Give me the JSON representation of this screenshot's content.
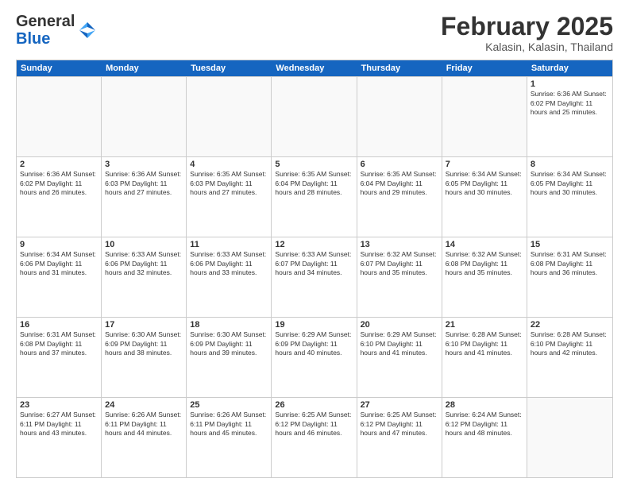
{
  "logo": {
    "general": "General",
    "blue": "Blue"
  },
  "header": {
    "month": "February 2025",
    "location": "Kalasin, Kalasin, Thailand"
  },
  "weekdays": [
    "Sunday",
    "Monday",
    "Tuesday",
    "Wednesday",
    "Thursday",
    "Friday",
    "Saturday"
  ],
  "rows": [
    [
      {
        "day": "",
        "info": ""
      },
      {
        "day": "",
        "info": ""
      },
      {
        "day": "",
        "info": ""
      },
      {
        "day": "",
        "info": ""
      },
      {
        "day": "",
        "info": ""
      },
      {
        "day": "",
        "info": ""
      },
      {
        "day": "1",
        "info": "Sunrise: 6:36 AM\nSunset: 6:02 PM\nDaylight: 11 hours and 25 minutes."
      }
    ],
    [
      {
        "day": "2",
        "info": "Sunrise: 6:36 AM\nSunset: 6:02 PM\nDaylight: 11 hours and 26 minutes."
      },
      {
        "day": "3",
        "info": "Sunrise: 6:36 AM\nSunset: 6:03 PM\nDaylight: 11 hours and 27 minutes."
      },
      {
        "day": "4",
        "info": "Sunrise: 6:35 AM\nSunset: 6:03 PM\nDaylight: 11 hours and 27 minutes."
      },
      {
        "day": "5",
        "info": "Sunrise: 6:35 AM\nSunset: 6:04 PM\nDaylight: 11 hours and 28 minutes."
      },
      {
        "day": "6",
        "info": "Sunrise: 6:35 AM\nSunset: 6:04 PM\nDaylight: 11 hours and 29 minutes."
      },
      {
        "day": "7",
        "info": "Sunrise: 6:34 AM\nSunset: 6:05 PM\nDaylight: 11 hours and 30 minutes."
      },
      {
        "day": "8",
        "info": "Sunrise: 6:34 AM\nSunset: 6:05 PM\nDaylight: 11 hours and 30 minutes."
      }
    ],
    [
      {
        "day": "9",
        "info": "Sunrise: 6:34 AM\nSunset: 6:06 PM\nDaylight: 11 hours and 31 minutes."
      },
      {
        "day": "10",
        "info": "Sunrise: 6:33 AM\nSunset: 6:06 PM\nDaylight: 11 hours and 32 minutes."
      },
      {
        "day": "11",
        "info": "Sunrise: 6:33 AM\nSunset: 6:06 PM\nDaylight: 11 hours and 33 minutes."
      },
      {
        "day": "12",
        "info": "Sunrise: 6:33 AM\nSunset: 6:07 PM\nDaylight: 11 hours and 34 minutes."
      },
      {
        "day": "13",
        "info": "Sunrise: 6:32 AM\nSunset: 6:07 PM\nDaylight: 11 hours and 35 minutes."
      },
      {
        "day": "14",
        "info": "Sunrise: 6:32 AM\nSunset: 6:08 PM\nDaylight: 11 hours and 35 minutes."
      },
      {
        "day": "15",
        "info": "Sunrise: 6:31 AM\nSunset: 6:08 PM\nDaylight: 11 hours and 36 minutes."
      }
    ],
    [
      {
        "day": "16",
        "info": "Sunrise: 6:31 AM\nSunset: 6:08 PM\nDaylight: 11 hours and 37 minutes."
      },
      {
        "day": "17",
        "info": "Sunrise: 6:30 AM\nSunset: 6:09 PM\nDaylight: 11 hours and 38 minutes."
      },
      {
        "day": "18",
        "info": "Sunrise: 6:30 AM\nSunset: 6:09 PM\nDaylight: 11 hours and 39 minutes."
      },
      {
        "day": "19",
        "info": "Sunrise: 6:29 AM\nSunset: 6:09 PM\nDaylight: 11 hours and 40 minutes."
      },
      {
        "day": "20",
        "info": "Sunrise: 6:29 AM\nSunset: 6:10 PM\nDaylight: 11 hours and 41 minutes."
      },
      {
        "day": "21",
        "info": "Sunrise: 6:28 AM\nSunset: 6:10 PM\nDaylight: 11 hours and 41 minutes."
      },
      {
        "day": "22",
        "info": "Sunrise: 6:28 AM\nSunset: 6:10 PM\nDaylight: 11 hours and 42 minutes."
      }
    ],
    [
      {
        "day": "23",
        "info": "Sunrise: 6:27 AM\nSunset: 6:11 PM\nDaylight: 11 hours and 43 minutes."
      },
      {
        "day": "24",
        "info": "Sunrise: 6:26 AM\nSunset: 6:11 PM\nDaylight: 11 hours and 44 minutes."
      },
      {
        "day": "25",
        "info": "Sunrise: 6:26 AM\nSunset: 6:11 PM\nDaylight: 11 hours and 45 minutes."
      },
      {
        "day": "26",
        "info": "Sunrise: 6:25 AM\nSunset: 6:12 PM\nDaylight: 11 hours and 46 minutes."
      },
      {
        "day": "27",
        "info": "Sunrise: 6:25 AM\nSunset: 6:12 PM\nDaylight: 11 hours and 47 minutes."
      },
      {
        "day": "28",
        "info": "Sunrise: 6:24 AM\nSunset: 6:12 PM\nDaylight: 11 hours and 48 minutes."
      },
      {
        "day": "",
        "info": ""
      }
    ]
  ]
}
